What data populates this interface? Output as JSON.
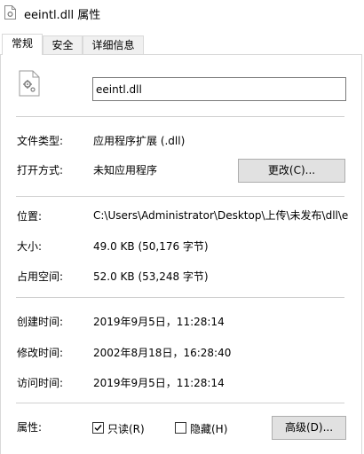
{
  "window": {
    "title": "eeintl.dll 属性",
    "icon": "dll-file-icon"
  },
  "tabs": [
    {
      "label": "常规",
      "active": true
    },
    {
      "label": "安全",
      "active": false
    },
    {
      "label": "详细信息",
      "active": false
    }
  ],
  "file": {
    "icon": "dll-gear-file-icon",
    "name": "eeintl.dll"
  },
  "properties": {
    "type_label": "文件类型:",
    "type_value": "应用程序扩展 (.dll)",
    "open_label": "打开方式:",
    "open_value": "未知应用程序",
    "change_button": "更改(C)...",
    "location_label": "位置:",
    "location_value": "C:\\Users\\Administrator\\Desktop\\上传\\未发布\\dll\\e",
    "size_label": "大小:",
    "size_value": "49.0 KB (50,176 字节)",
    "disk_label": "占用空间:",
    "disk_value": "52.0 KB (53,248 字节)",
    "created_label": "创建时间:",
    "created_value": "2019年9月5日，11:28:14",
    "modified_label": "修改时间:",
    "modified_value": "2002年8月18日，16:28:40",
    "accessed_label": "访问时间:",
    "accessed_value": "2019年9月5日，11:28:14",
    "attributes_label": "属性:"
  },
  "attributes": {
    "readonly_label": "只读(R)",
    "readonly_checked": true,
    "hidden_label": "隐藏(H)",
    "hidden_checked": false,
    "advanced_button": "高级(D)..."
  }
}
